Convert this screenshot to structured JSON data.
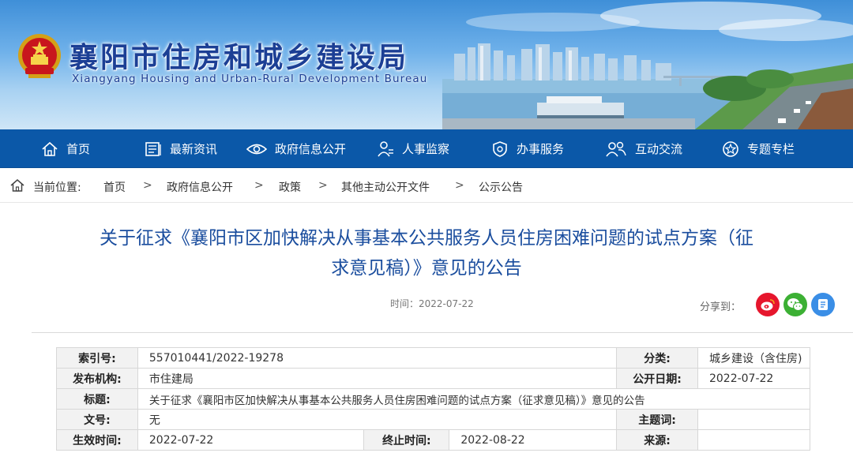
{
  "header": {
    "title": "襄阳市住房和城乡建设局",
    "subtitle": "Xiangyang Housing and Urban-Rural Development Bureau",
    "emblem_icon": "national-emblem-icon"
  },
  "nav": {
    "items": [
      {
        "label": "首页",
        "icon": "home-icon"
      },
      {
        "label": "最新资讯",
        "icon": "news-icon"
      },
      {
        "label": "政府信息公开",
        "icon": "eye-icon"
      },
      {
        "label": "人事监察",
        "icon": "person-icon"
      },
      {
        "label": "办事服务",
        "icon": "shield-icon"
      },
      {
        "label": "互动交流",
        "icon": "people-icon"
      },
      {
        "label": "专题专栏",
        "icon": "star-icon"
      }
    ],
    "bg_color": "#0b58a8"
  },
  "breadcrumb": {
    "label": "当前位置:",
    "items": [
      "首页",
      "政府信息公开",
      "政策",
      "其他主动公开文件",
      "公示公告"
    ],
    "separator": ">"
  },
  "article": {
    "title_line1": "关于征求《襄阳市区加快解决从事基本公共服务人员住房困难问题的试点方案（征",
    "title_line2": "求意见稿）》意见的公告",
    "time": "时间：2022-07-22",
    "share_label": "分享到：",
    "share_buttons": [
      {
        "icon": "weibo-icon",
        "color": "#e6162d"
      },
      {
        "icon": "wechat-icon",
        "color": "#3cb034"
      },
      {
        "icon": "qzone-icon",
        "color": "#3a8ee6"
      }
    ],
    "title_color": "#1a4d9e"
  },
  "meta": {
    "index_no_label": "索引号:",
    "index_no": "557010441/2022-19278",
    "category_label": "分类:",
    "category": "城乡建设（含住房)",
    "publisher_label": "发布机构:",
    "publisher": "市住建局",
    "publish_date_label": "公开日期:",
    "publish_date": "2022-07-22",
    "title_label": "标题:",
    "title": "关于征求《襄阳市区加快解决从事基本公共服务人员住房困难问题的试点方案（征求意见稿）》意见的公告",
    "doc_no_label": "文号:",
    "doc_no": "无",
    "keywords_label": "主题词:",
    "keywords": "",
    "effective_label": "生效时间:",
    "effective": "2022-07-22",
    "end_label": "终止时间:",
    "end": "2022-08-22",
    "source_label": "来源:",
    "source": ""
  }
}
